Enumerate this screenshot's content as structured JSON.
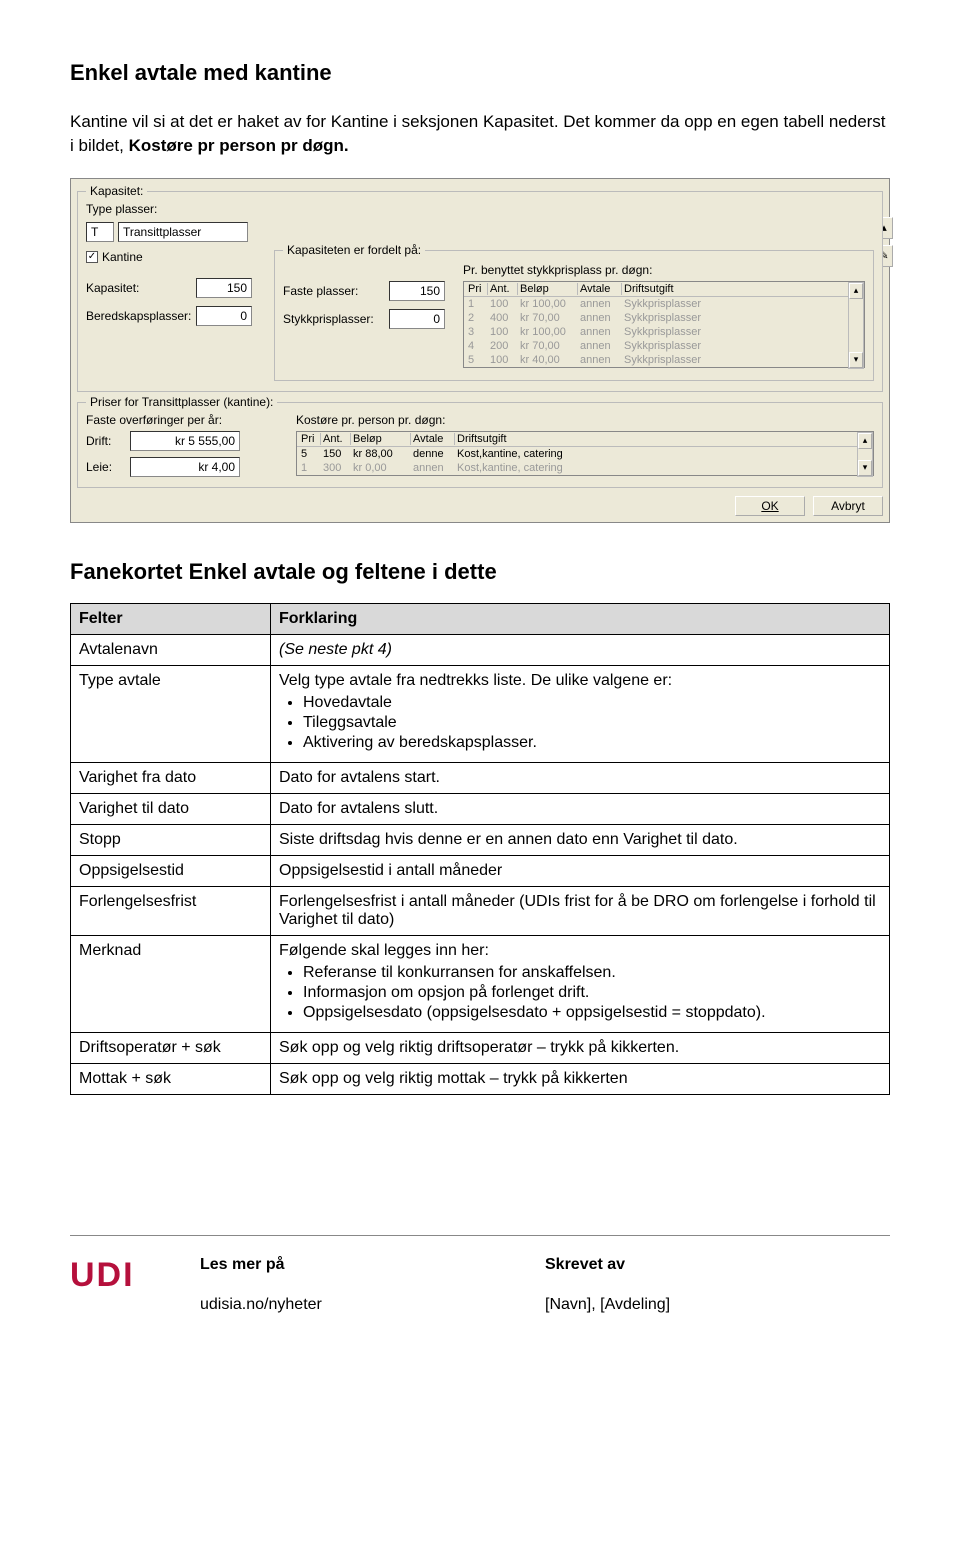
{
  "page": {
    "title": "Enkel avtale med kantine",
    "intro_part1": "Kantine vil si at det er haket av for Kantine i seksjonen Kapasitet. Det kommer da opp en egen tabell nederst i bildet, ",
    "intro_bold": "Kostøre pr person pr døgn.",
    "h2": "Fanekortet Enkel avtale og feltene i dette"
  },
  "shot": {
    "kapasitet": {
      "group": "Kapasitet:",
      "type_plasser_lbl": "Type plasser:",
      "type_plasser_code": "T",
      "type_plasser_val": "Transittplasser",
      "kantine_chk_lbl": "Kantine",
      "kapasitet_lbl": "Kapasitet:",
      "kapasitet_val": "150",
      "beredskap_lbl": "Beredskapsplasser:",
      "beredskap_val": "0",
      "fordelt_group": "Kapasiteten er fordelt på:",
      "faste_lbl": "Faste plasser:",
      "faste_val": "150",
      "stykk_lbl": "Stykkprisplasser:",
      "stykk_val": "0",
      "pris_group": "Pr. benyttet stykkprisplass pr. døgn:",
      "pris_hdr_pri": "Pri",
      "pris_hdr_ant": "Ant.",
      "pris_hdr_belop": "Beløp",
      "pris_hdr_avtale": "Avtale",
      "pris_hdr_drift": "Driftsutgift",
      "pris_rows": [
        {
          "pri": "1",
          "ant": "100",
          "belop": "kr 100,00",
          "avtale": "annen",
          "drift": "Sykkprisplasser"
        },
        {
          "pri": "2",
          "ant": "400",
          "belop": "kr 70,00",
          "avtale": "annen",
          "drift": "Sykkprisplasser"
        },
        {
          "pri": "3",
          "ant": "100",
          "belop": "kr 100,00",
          "avtale": "annen",
          "drift": "Sykkprisplasser"
        },
        {
          "pri": "4",
          "ant": "200",
          "belop": "kr 70,00",
          "avtale": "annen",
          "drift": "Sykkprisplasser"
        },
        {
          "pri": "5",
          "ant": "100",
          "belop": "kr 40,00",
          "avtale": "annen",
          "drift": "Sykkprisplasser"
        }
      ]
    },
    "priser": {
      "group": "Priser for Transittplasser (kantine):",
      "faste_ar_lbl": "Faste overføringer per år:",
      "drift_lbl": "Drift:",
      "drift_val": "kr 5 555,00",
      "leie_lbl": "Leie:",
      "leie_val": "kr 4,00",
      "kost_group": "Kostøre pr. person pr. døgn:",
      "hdr_pri": "Pri",
      "hdr_ant": "Ant.",
      "hdr_belop": "Beløp",
      "hdr_avtale": "Avtale",
      "hdr_drift": "Driftsutgift",
      "rows": [
        {
          "pri": "5",
          "ant": "150",
          "belop": "kr 88,00",
          "avtale": "denne",
          "drift": "Kost,kantine, catering",
          "sel": true
        },
        {
          "pri": "1",
          "ant": "300",
          "belop": "kr 0,00",
          "avtale": "annen",
          "drift": "Kost,kantine, catering",
          "sel": false
        }
      ]
    },
    "ok_btn": "OK",
    "avbryt_btn": "Avbryt"
  },
  "table": {
    "hdr_felter": "Felter",
    "hdr_forklaring": "Forklaring",
    "rows": [
      {
        "f": "Avtalenavn",
        "v_italic": "(Se neste pkt 4)"
      },
      {
        "f": "Type avtale",
        "v": "Velg type avtale fra nedtrekks liste. De ulike valgene er:",
        "bul": [
          "Hovedavtale",
          "Tileggsavtale",
          "Aktivering av beredskapsplasser."
        ]
      },
      {
        "f": "Varighet fra dato",
        "v": "Dato for avtalens start."
      },
      {
        "f": "Varighet til dato",
        "v": "Dato for avtalens slutt."
      },
      {
        "f": "Stopp",
        "v": "Siste driftsdag hvis denne er en annen dato enn Varighet til dato."
      },
      {
        "f": "Oppsigelsestid",
        "v": "Oppsigelsestid i antall måneder"
      },
      {
        "f": "Forlengelsesfrist",
        "v": "Forlengelsesfrist i antall måneder (UDIs frist for å be DRO om forlengelse i forhold til Varighet til dato)"
      },
      {
        "f": "Merknad",
        "v": "Følgende skal legges inn her:",
        "bul": [
          "Referanse til konkurransen for anskaffelsen.",
          "Informasjon om opsjon på forlenget drift.",
          "Oppsigelsesdato (oppsigelsesdato + oppsigelsestid = stoppdato)."
        ]
      },
      {
        "f": "Driftsoperatør + søk",
        "v": "Søk opp og velg riktig driftsoperatør – trykk på kikkerten."
      },
      {
        "f": "Mottak + søk",
        "v": "Søk opp og velg riktig mottak – trykk på kikkerten"
      }
    ]
  },
  "footer": {
    "logo": "UDI",
    "col1_hdr": "Les mer på",
    "col1_val": "udisia.no/nyheter",
    "col2_hdr": "Skrevet av",
    "col2_val": "[Navn], [Avdeling]"
  }
}
